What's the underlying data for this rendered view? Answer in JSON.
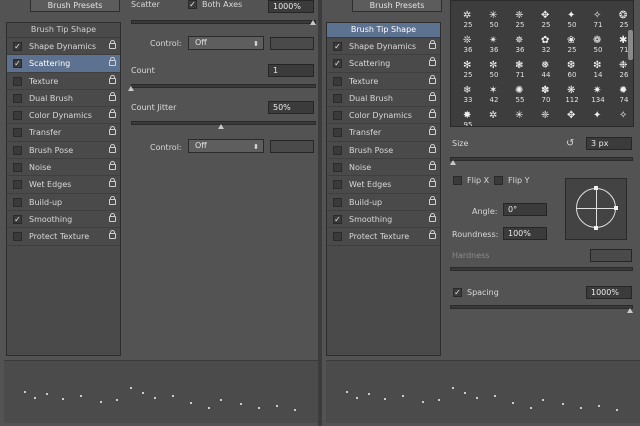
{
  "left": {
    "presets_button": "Brush Presets",
    "list_header": "Brush Tip Shape",
    "items": [
      {
        "label": "Shape Dynamics",
        "checked": true,
        "selected": false
      },
      {
        "label": "Scattering",
        "checked": true,
        "selected": true
      },
      {
        "label": "Texture",
        "checked": false,
        "selected": false
      },
      {
        "label": "Dual Brush",
        "checked": false,
        "selected": false
      },
      {
        "label": "Color Dynamics",
        "checked": false,
        "selected": false
      },
      {
        "label": "Transfer",
        "checked": false,
        "selected": false
      },
      {
        "label": "Brush Pose",
        "checked": false,
        "selected": false
      },
      {
        "label": "Noise",
        "checked": false,
        "selected": false
      },
      {
        "label": "Wet Edges",
        "checked": false,
        "selected": false
      },
      {
        "label": "Build-up",
        "checked": false,
        "selected": false
      },
      {
        "label": "Smoothing",
        "checked": true,
        "selected": false
      },
      {
        "label": "Protect Texture",
        "checked": false,
        "selected": false
      }
    ],
    "scatter": {
      "label": "Scatter",
      "both_axes": "Both Axes",
      "value": "1000%"
    },
    "control1": {
      "label": "Control:",
      "value": "Off"
    },
    "count": {
      "label": "Count",
      "value": "1"
    },
    "count_jitter": {
      "label": "Count Jitter",
      "value": "50%"
    },
    "control2": {
      "label": "Control:",
      "value": "Off"
    }
  },
  "right": {
    "presets_button": "Brush Presets",
    "list_header": "Brush Tip Shape",
    "items": [
      {
        "label": "Shape Dynamics",
        "checked": true,
        "selected": false
      },
      {
        "label": "Scattering",
        "checked": true,
        "selected": false
      },
      {
        "label": "Texture",
        "checked": false,
        "selected": false
      },
      {
        "label": "Dual Brush",
        "checked": false,
        "selected": false
      },
      {
        "label": "Color Dynamics",
        "checked": false,
        "selected": false
      },
      {
        "label": "Transfer",
        "checked": false,
        "selected": false
      },
      {
        "label": "Brush Pose",
        "checked": false,
        "selected": false
      },
      {
        "label": "Noise",
        "checked": false,
        "selected": false
      },
      {
        "label": "Wet Edges",
        "checked": false,
        "selected": false
      },
      {
        "label": "Build-up",
        "checked": false,
        "selected": false
      },
      {
        "label": "Smoothing",
        "checked": true,
        "selected": false
      },
      {
        "label": "Protect Texture",
        "checked": false,
        "selected": false
      }
    ],
    "brush_numbers": [
      "25",
      "50",
      "25",
      "25",
      "50",
      "71",
      "25",
      "36",
      "36",
      "36",
      "32",
      "25",
      "50",
      "71",
      "25",
      "50",
      "71",
      "44",
      "60",
      "14",
      "26",
      "33",
      "42",
      "55",
      "70",
      "112",
      "134",
      "74",
      "95"
    ],
    "size": {
      "label": "Size",
      "value": "3 px"
    },
    "flip_x": "Flip X",
    "flip_y": "Flip Y",
    "angle": {
      "label": "Angle:",
      "value": "0°"
    },
    "roundness": {
      "label": "Roundness:",
      "value": "100%"
    },
    "hardness": {
      "label": "Hardness"
    },
    "spacing": {
      "label": "Spacing",
      "value": "1000%"
    }
  }
}
